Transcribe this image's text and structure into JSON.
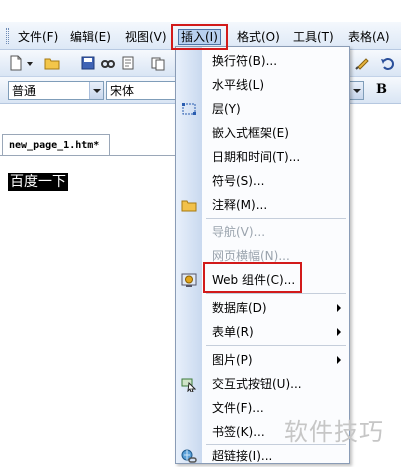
{
  "menubar": {
    "items": [
      {
        "label": "文件(F)"
      },
      {
        "label": "编辑(E)"
      },
      {
        "label": "视图(V)"
      },
      {
        "label": "插入(I)",
        "active": true
      },
      {
        "label": "格式(O)"
      },
      {
        "label": "工具(T)"
      },
      {
        "label": "表格(A)"
      }
    ]
  },
  "toolbar": {
    "style_value": "普通",
    "font_value": "宋体",
    "bold_label": "B"
  },
  "editor": {
    "tab_label": "new_page_1.htm*",
    "selected_text": "百度一下"
  },
  "insert_menu": {
    "items": [
      {
        "label": "换行符(B)..."
      },
      {
        "label": "水平线(L)"
      },
      {
        "label": "层(Y)",
        "icon": "layer-icon"
      },
      {
        "label": "嵌入式框架(E)"
      },
      {
        "label": "日期和时间(T)..."
      },
      {
        "label": "符号(S)..."
      },
      {
        "label": "注释(M)...",
        "icon": "folder-icon"
      },
      {
        "label": "导航(V)...",
        "disabled": true
      },
      {
        "label": "网页横幅(N)...",
        "disabled": true
      },
      {
        "label": "Web 组件(C)...",
        "icon": "web-component-icon",
        "highlighted": true
      },
      {
        "label": "数据库(D)",
        "submenu": true
      },
      {
        "label": "表单(R)",
        "submenu": true
      },
      {
        "label": "图片(P)",
        "submenu": true
      },
      {
        "label": "交互式按钮(U)...",
        "icon": "interactive-button-icon"
      },
      {
        "label": "文件(F)..."
      },
      {
        "label": "书签(K)..."
      },
      {
        "label": "超链接(I)...",
        "icon": "hyperlink-icon"
      }
    ]
  },
  "watermark": "软件技巧",
  "colors": {
    "highlight_box": "#d21a1a",
    "menu_active": "#b8d0ef",
    "disabled_text": "#9aa3ad"
  }
}
